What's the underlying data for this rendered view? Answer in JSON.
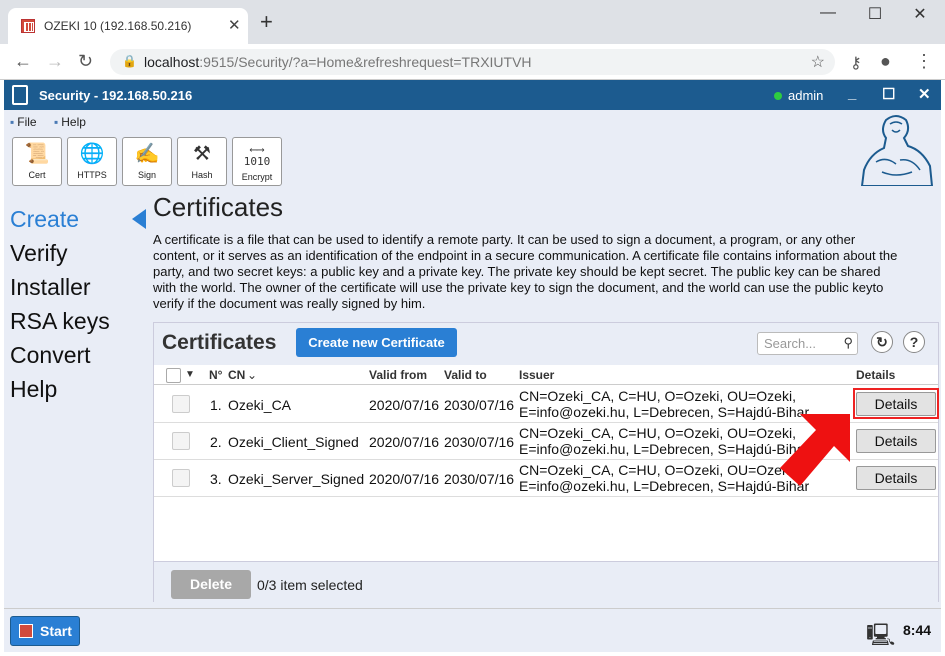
{
  "browser": {
    "tab_title": "OZEKI 10 (192.168.50.216)",
    "url_host": "localhost",
    "url_rest": ":9515/Security/?a=Home&refreshrequest=TRXIUTVH"
  },
  "app": {
    "title": "Security - 192.168.50.216",
    "user": "admin"
  },
  "menu": [
    "File",
    "Help"
  ],
  "toolbar": [
    {
      "label": "Cert",
      "icon": "certificate-icon"
    },
    {
      "label": "HTTPS",
      "icon": "globe-icon"
    },
    {
      "label": "Sign",
      "icon": "sign-icon"
    },
    {
      "label": "Hash",
      "icon": "hammer-icon"
    },
    {
      "label": "Encrypt",
      "icon": "encrypt-icon"
    }
  ],
  "sidebar": [
    {
      "label": "Create"
    },
    {
      "label": "Verify"
    },
    {
      "label": "Installer"
    },
    {
      "label": "RSA keys"
    },
    {
      "label": "Convert"
    },
    {
      "label": "Help"
    }
  ],
  "main": {
    "title": "Certificates",
    "description": "A certificate is a file that can be used to identify a remote party. It can be used to sign a document, a program, or any other content, or it serves as an identification of the endpoint in a secure communication. A certificate file contains information about the party, and two secret keys: a public key and a private key. The private key should be kept secret. The public key can be shared with the world. The owner of the certificate will use the private key to sign the document, and the world can use the public keyto verify if the document was really signed by him."
  },
  "panel": {
    "title": "Certificates",
    "create_button": "Create new Certificate",
    "search_placeholder": "Search...",
    "columns": [
      "N°",
      "CN",
      "Valid from",
      "Valid to",
      "Issuer",
      "Details"
    ],
    "rows": [
      {
        "n": "1.",
        "cn": "Ozeki_CA",
        "from": "2020/07/16",
        "to": "2030/07/16",
        "issuer1": "CN=Ozeki_CA, C=HU, O=Ozeki, OU=Ozeki,",
        "issuer2": "E=info@ozeki.hu, L=Debrecen, S=Hajdú-Bihar",
        "details": "Details"
      },
      {
        "n": "2.",
        "cn": "Ozeki_Client_Signed",
        "from": "2020/07/16",
        "to": "2030/07/16",
        "issuer1": "CN=Ozeki_CA, C=HU, O=Ozeki, OU=Ozeki,",
        "issuer2": "E=info@ozeki.hu, L=Debrecen, S=Hajdú-Bihar",
        "details": "Details"
      },
      {
        "n": "3.",
        "cn": "Ozeki_Server_Signed",
        "from": "2020/07/16",
        "to": "2030/07/16",
        "issuer1": "CN=Ozeki_CA, C=HU, O=Ozeki, OU=Ozeki,",
        "issuer2": "E=info@ozeki.hu, L=Debrecen, S=Hajdú-Bihar",
        "details": "Details"
      }
    ],
    "delete_button": "Delete",
    "selection_info": "0/3 item selected"
  },
  "taskbar": {
    "start": "Start",
    "clock": "8:44"
  }
}
